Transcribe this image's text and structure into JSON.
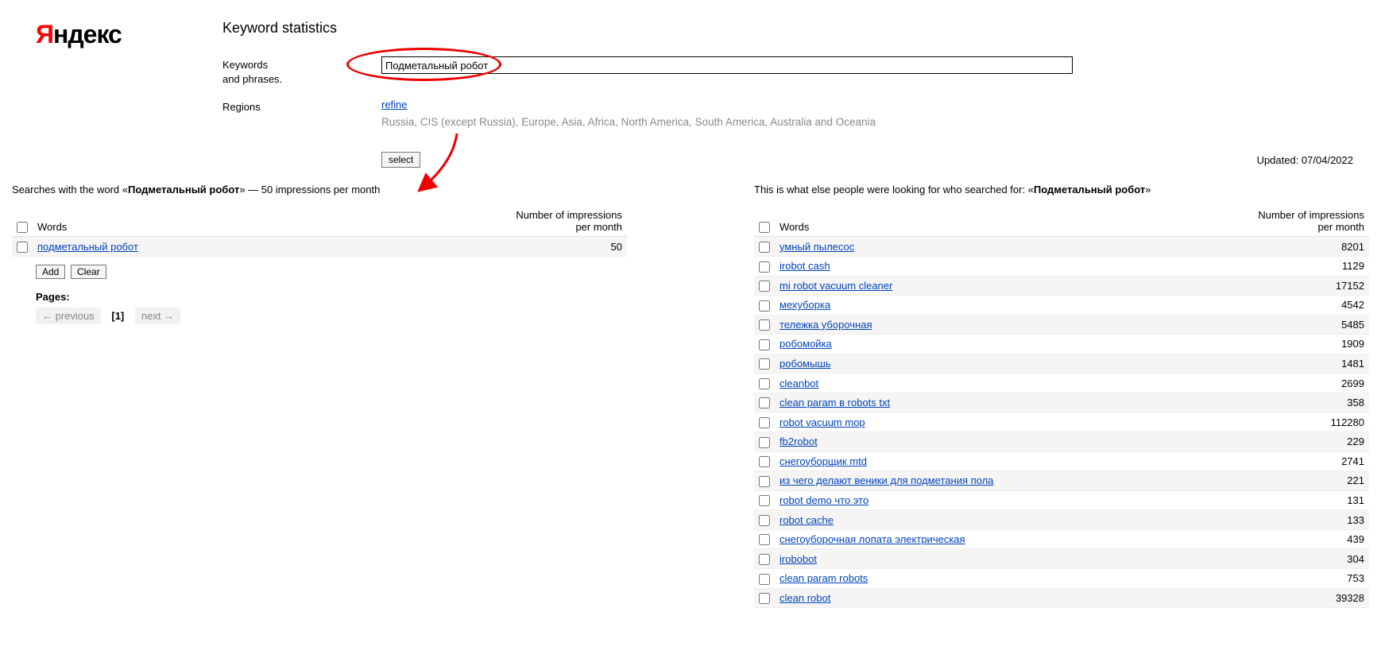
{
  "logo": {
    "red": "Я",
    "black": "ндекс"
  },
  "page_title": "Keyword statistics",
  "form": {
    "keywords_label_line1": "Keywords",
    "keywords_label_line2": "and phrases.",
    "keyword_value": "Подметальный робот",
    "regions_label": "Regions",
    "refine": "refine",
    "regions_list": "Russia, CIS (except Russia), Europe, Asia, Africa, North America, South America, Australia and Oceania",
    "select_button": "select",
    "updated": "Updated: 07/04/2022"
  },
  "left": {
    "heading_prefix": "Searches with the word «",
    "heading_keyword": "Подметальный робот",
    "heading_suffix": "» — 50 impressions per month",
    "col_words": "Words",
    "col_impr_line1": "Number of impressions",
    "col_impr_line2": "per month",
    "rows": [
      {
        "word": "подметальный робот",
        "impressions": "50"
      }
    ],
    "add_button": "Add",
    "clear_button": "Clear",
    "pages_label": "Pages:",
    "prev": "←  previous",
    "current_page": "[1]",
    "next": "next  →"
  },
  "right": {
    "heading_prefix": "This is what else people were looking for who searched for: «",
    "heading_keyword": "Подметальный робот",
    "heading_suffix": "»",
    "col_words": "Words",
    "col_impr_line1": "Number of impressions",
    "col_impr_line2": "per month",
    "rows": [
      {
        "word": "умный пылесос",
        "impressions": "8201"
      },
      {
        "word": "irobot cash",
        "impressions": "1129"
      },
      {
        "word": "mi robot vacuum cleaner",
        "impressions": "17152"
      },
      {
        "word": "мехуборка",
        "impressions": "4542"
      },
      {
        "word": "тележка уборочная",
        "impressions": "5485"
      },
      {
        "word": "робомойка",
        "impressions": "1909"
      },
      {
        "word": "робомышь",
        "impressions": "1481"
      },
      {
        "word": "cleanbot",
        "impressions": "2699"
      },
      {
        "word": "clean param в robots txt",
        "impressions": "358"
      },
      {
        "word": "robot vacuum mop",
        "impressions": "112280"
      },
      {
        "word": "fb2robot",
        "impressions": "229"
      },
      {
        "word": "снегоуборщик mtd",
        "impressions": "2741"
      },
      {
        "word": "из чего делают веники для подметания пола",
        "impressions": "221"
      },
      {
        "word": "robot demo что это",
        "impressions": "131"
      },
      {
        "word": "robot cache",
        "impressions": "133"
      },
      {
        "word": "снегоуборочная лопата электрическая",
        "impressions": "439"
      },
      {
        "word": "irobobot",
        "impressions": "304"
      },
      {
        "word": "clean param robots",
        "impressions": "753"
      },
      {
        "word": "clean robot",
        "impressions": "39328"
      }
    ]
  }
}
